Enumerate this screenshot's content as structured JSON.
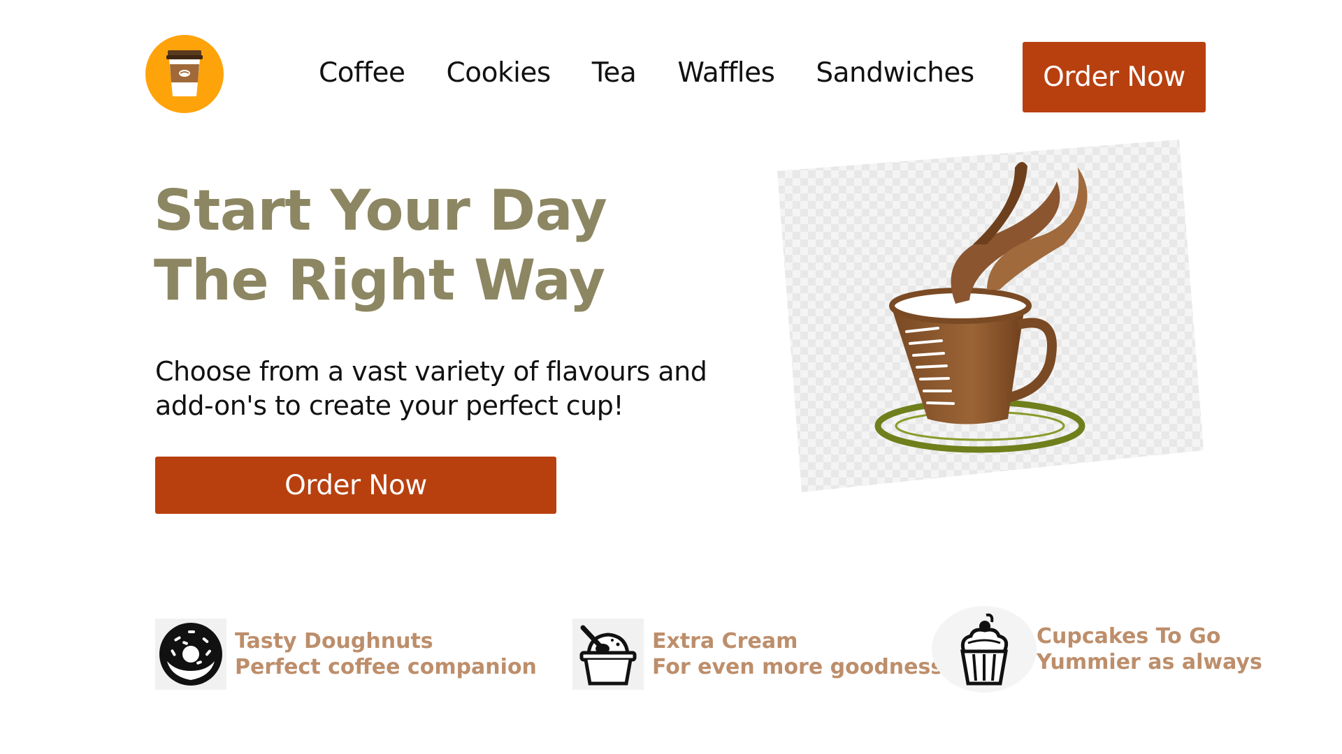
{
  "header": {
    "logo_icon": "coffee-cup-icon",
    "nav": [
      "Coffee",
      "Cookies",
      "Tea",
      "Waffles",
      "Sandwiches"
    ],
    "order_button": "Order Now"
  },
  "hero": {
    "title_line1": "Start Your Day",
    "title_line2": "The Right Way",
    "description_line1": "Choose from a vast variety of flavours and",
    "description_line2": "add-on's to create your perfect cup!",
    "order_button": "Order Now",
    "image": "steaming-coffee-cup-illustration"
  },
  "features": [
    {
      "icon": "doughnut-icon",
      "title": "Tasty Doughnuts",
      "subtitle": "Perfect coffee companion"
    },
    {
      "icon": "ice-cream-tub-icon",
      "title": "Extra Cream",
      "subtitle": "For even more goodness"
    },
    {
      "icon": "cupcake-icon",
      "title": "Cupcakes To Go",
      "subtitle": "Yummier as always"
    }
  ],
  "colors": {
    "accent": "#b8400f",
    "logo_bg": "#ffa30a",
    "heading": "#8c8762",
    "feature_text": "#bd8e6b",
    "cup_brown": "#8b5530",
    "saucer_green": "#6f7f1c"
  }
}
